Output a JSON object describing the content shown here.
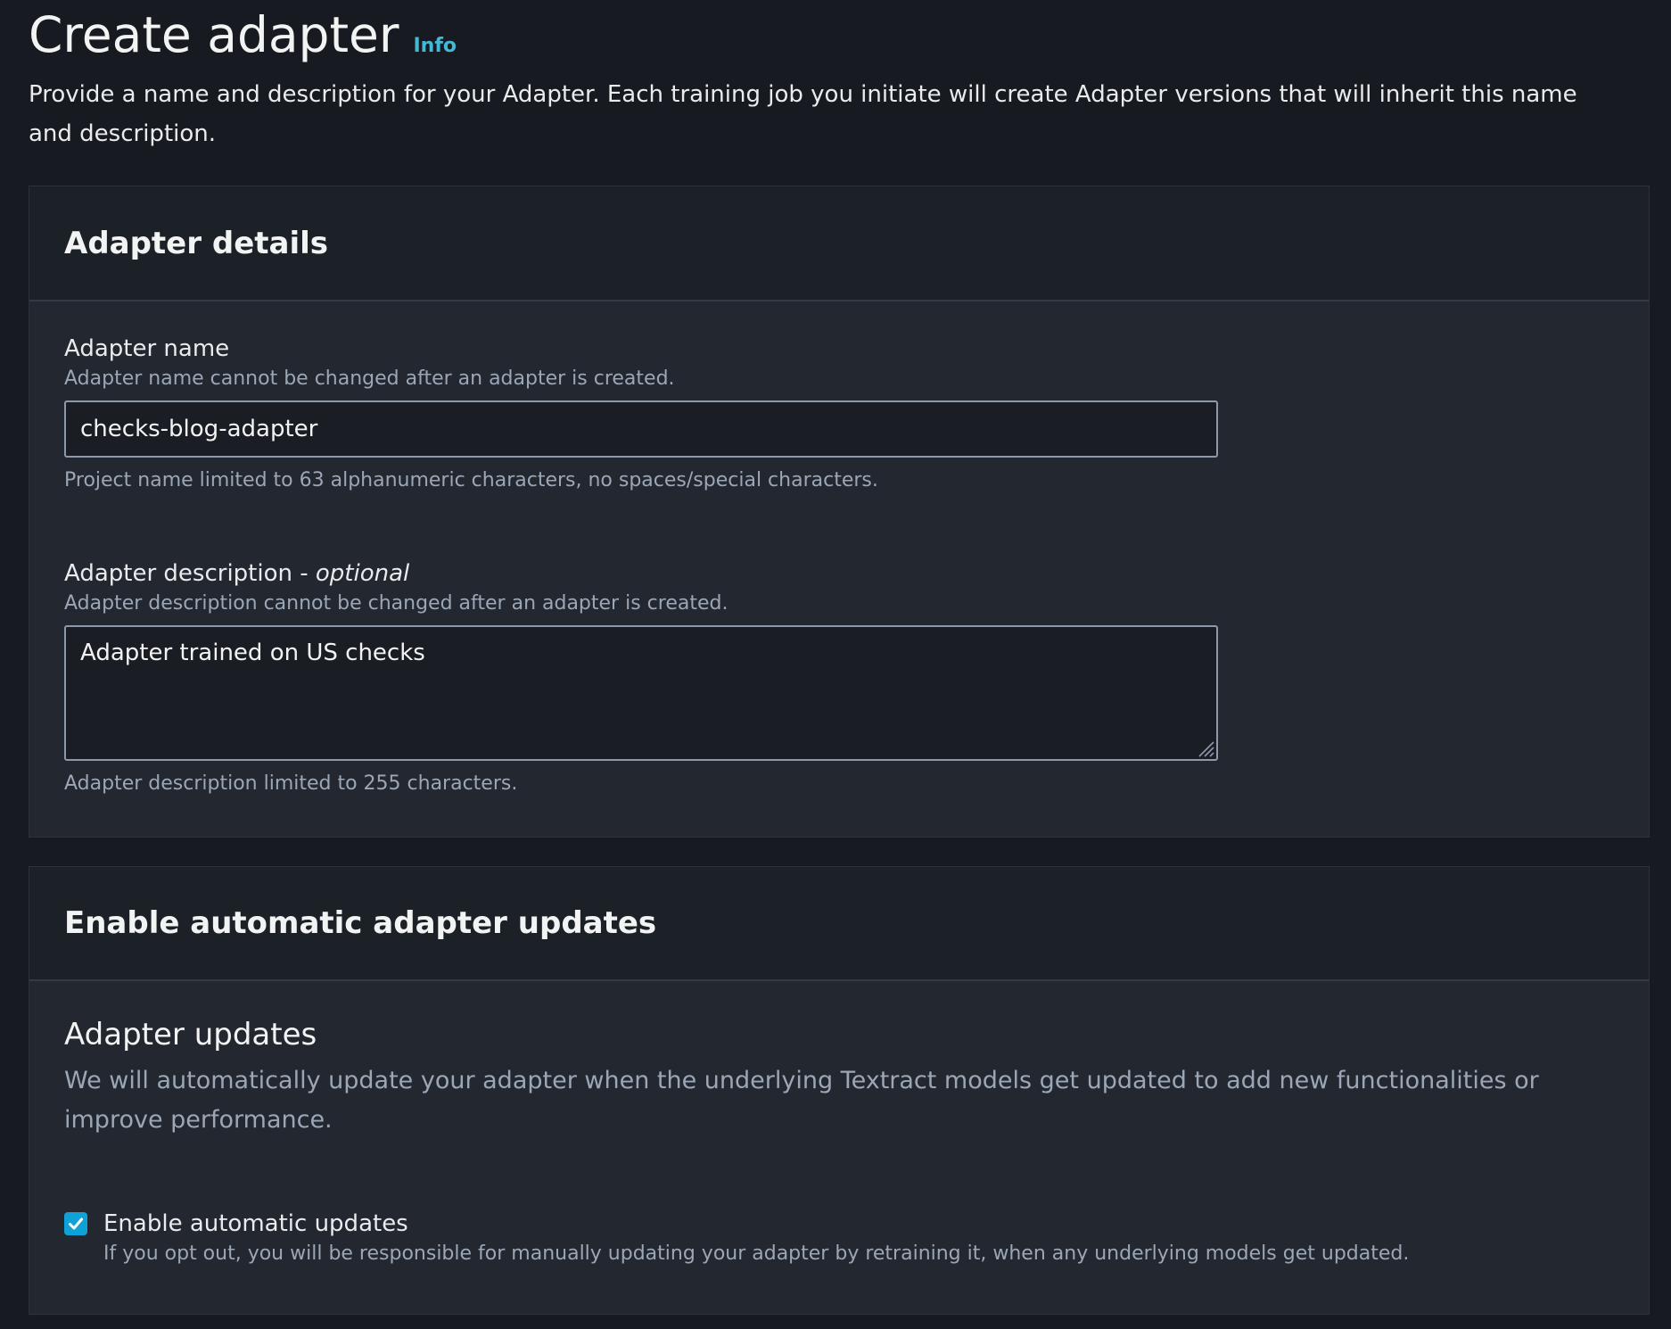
{
  "page": {
    "title": "Create adapter",
    "info_link": "Info",
    "description": "Provide a name and description for your Adapter. Each training job you initiate will create Adapter versions that will inherit this name and description."
  },
  "adapter_details": {
    "title": "Adapter details",
    "name_field": {
      "label": "Adapter name",
      "hint": "Adapter name cannot be changed after an adapter is created.",
      "value": "checks-blog-adapter",
      "constraint": "Project name limited to 63 alphanumeric characters, no spaces/special characters."
    },
    "description_field": {
      "label": "Adapter description - ",
      "label_optional": "optional",
      "hint": "Adapter description cannot be changed after an adapter is created.",
      "value": "Adapter trained on US checks",
      "constraint": "Adapter description limited to 255 characters."
    }
  },
  "auto_updates": {
    "title": "Enable automatic adapter updates",
    "section_heading": "Adapter updates",
    "section_description": "We will automatically update your adapter when the underlying Textract models get updated to add new functionalities or improve performance.",
    "checkbox": {
      "checked": true,
      "label": "Enable automatic updates",
      "description": "If you opt out, you will be responsible for manually updating your adapter by retraining it, when any underlying models get updated."
    }
  },
  "colors": {
    "background": "#171a20",
    "container": "#232730",
    "container_header": "#1c2027",
    "accent_link": "#44b9d6",
    "checkbox": "#0ea2d6",
    "hint_text": "#9ba7b6"
  },
  "icons": {
    "checkbox_check": "checkmark-icon",
    "textarea_resize": "resize-handle-icon"
  }
}
